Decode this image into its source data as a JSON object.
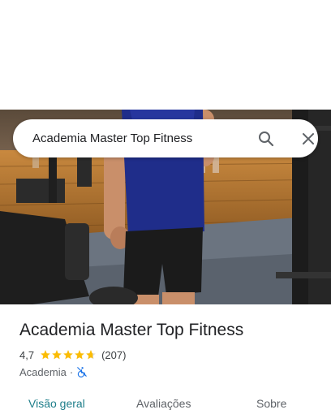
{
  "search": {
    "query": "Academia Master Top Fitness"
  },
  "place": {
    "name": "Academia Master Top Fitness",
    "rating": "4,7",
    "stars": 4.7,
    "review_count": "(207)",
    "category": "Academia",
    "separator": "·",
    "accessibility_icon": "not-wheelchair-accessible-icon"
  },
  "tabs": [
    {
      "label": "Visão geral",
      "active": true
    },
    {
      "label": "Avaliações",
      "active": false
    },
    {
      "label": "Sobre",
      "active": false
    }
  ],
  "colors": {
    "star": "#fbbc04",
    "active_tab": "#1e7e8a",
    "accessibility_icon": "#1a73e8"
  }
}
